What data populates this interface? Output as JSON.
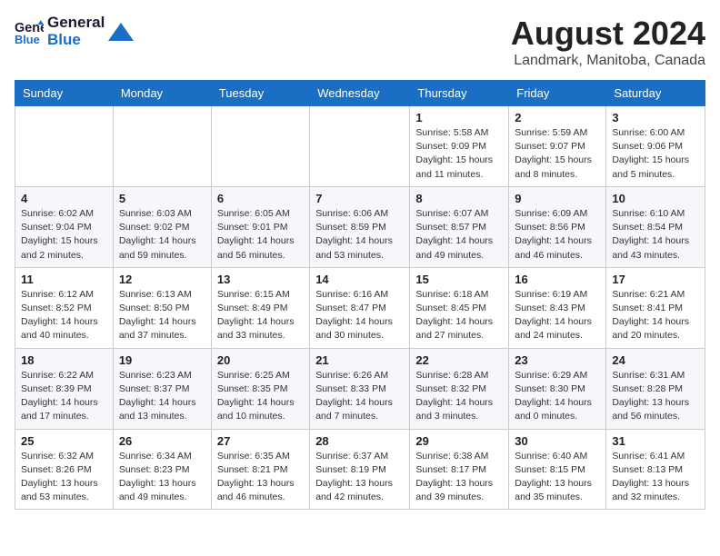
{
  "header": {
    "logo_line1": "General",
    "logo_line2": "Blue",
    "month_year": "August 2024",
    "location": "Landmark, Manitoba, Canada"
  },
  "days_of_week": [
    "Sunday",
    "Monday",
    "Tuesday",
    "Wednesday",
    "Thursday",
    "Friday",
    "Saturday"
  ],
  "weeks": [
    [
      {
        "day": "",
        "info": ""
      },
      {
        "day": "",
        "info": ""
      },
      {
        "day": "",
        "info": ""
      },
      {
        "day": "",
        "info": ""
      },
      {
        "day": "1",
        "info": "Sunrise: 5:58 AM\nSunset: 9:09 PM\nDaylight: 15 hours\nand 11 minutes."
      },
      {
        "day": "2",
        "info": "Sunrise: 5:59 AM\nSunset: 9:07 PM\nDaylight: 15 hours\nand 8 minutes."
      },
      {
        "day": "3",
        "info": "Sunrise: 6:00 AM\nSunset: 9:06 PM\nDaylight: 15 hours\nand 5 minutes."
      }
    ],
    [
      {
        "day": "4",
        "info": "Sunrise: 6:02 AM\nSunset: 9:04 PM\nDaylight: 15 hours\nand 2 minutes."
      },
      {
        "day": "5",
        "info": "Sunrise: 6:03 AM\nSunset: 9:02 PM\nDaylight: 14 hours\nand 59 minutes."
      },
      {
        "day": "6",
        "info": "Sunrise: 6:05 AM\nSunset: 9:01 PM\nDaylight: 14 hours\nand 56 minutes."
      },
      {
        "day": "7",
        "info": "Sunrise: 6:06 AM\nSunset: 8:59 PM\nDaylight: 14 hours\nand 53 minutes."
      },
      {
        "day": "8",
        "info": "Sunrise: 6:07 AM\nSunset: 8:57 PM\nDaylight: 14 hours\nand 49 minutes."
      },
      {
        "day": "9",
        "info": "Sunrise: 6:09 AM\nSunset: 8:56 PM\nDaylight: 14 hours\nand 46 minutes."
      },
      {
        "day": "10",
        "info": "Sunrise: 6:10 AM\nSunset: 8:54 PM\nDaylight: 14 hours\nand 43 minutes."
      }
    ],
    [
      {
        "day": "11",
        "info": "Sunrise: 6:12 AM\nSunset: 8:52 PM\nDaylight: 14 hours\nand 40 minutes."
      },
      {
        "day": "12",
        "info": "Sunrise: 6:13 AM\nSunset: 8:50 PM\nDaylight: 14 hours\nand 37 minutes."
      },
      {
        "day": "13",
        "info": "Sunrise: 6:15 AM\nSunset: 8:49 PM\nDaylight: 14 hours\nand 33 minutes."
      },
      {
        "day": "14",
        "info": "Sunrise: 6:16 AM\nSunset: 8:47 PM\nDaylight: 14 hours\nand 30 minutes."
      },
      {
        "day": "15",
        "info": "Sunrise: 6:18 AM\nSunset: 8:45 PM\nDaylight: 14 hours\nand 27 minutes."
      },
      {
        "day": "16",
        "info": "Sunrise: 6:19 AM\nSunset: 8:43 PM\nDaylight: 14 hours\nand 24 minutes."
      },
      {
        "day": "17",
        "info": "Sunrise: 6:21 AM\nSunset: 8:41 PM\nDaylight: 14 hours\nand 20 minutes."
      }
    ],
    [
      {
        "day": "18",
        "info": "Sunrise: 6:22 AM\nSunset: 8:39 PM\nDaylight: 14 hours\nand 17 minutes."
      },
      {
        "day": "19",
        "info": "Sunrise: 6:23 AM\nSunset: 8:37 PM\nDaylight: 14 hours\nand 13 minutes."
      },
      {
        "day": "20",
        "info": "Sunrise: 6:25 AM\nSunset: 8:35 PM\nDaylight: 14 hours\nand 10 minutes."
      },
      {
        "day": "21",
        "info": "Sunrise: 6:26 AM\nSunset: 8:33 PM\nDaylight: 14 hours\nand 7 minutes."
      },
      {
        "day": "22",
        "info": "Sunrise: 6:28 AM\nSunset: 8:32 PM\nDaylight: 14 hours\nand 3 minutes."
      },
      {
        "day": "23",
        "info": "Sunrise: 6:29 AM\nSunset: 8:30 PM\nDaylight: 14 hours\nand 0 minutes."
      },
      {
        "day": "24",
        "info": "Sunrise: 6:31 AM\nSunset: 8:28 PM\nDaylight: 13 hours\nand 56 minutes."
      }
    ],
    [
      {
        "day": "25",
        "info": "Sunrise: 6:32 AM\nSunset: 8:26 PM\nDaylight: 13 hours\nand 53 minutes."
      },
      {
        "day": "26",
        "info": "Sunrise: 6:34 AM\nSunset: 8:23 PM\nDaylight: 13 hours\nand 49 minutes."
      },
      {
        "day": "27",
        "info": "Sunrise: 6:35 AM\nSunset: 8:21 PM\nDaylight: 13 hours\nand 46 minutes."
      },
      {
        "day": "28",
        "info": "Sunrise: 6:37 AM\nSunset: 8:19 PM\nDaylight: 13 hours\nand 42 minutes."
      },
      {
        "day": "29",
        "info": "Sunrise: 6:38 AM\nSunset: 8:17 PM\nDaylight: 13 hours\nand 39 minutes."
      },
      {
        "day": "30",
        "info": "Sunrise: 6:40 AM\nSunset: 8:15 PM\nDaylight: 13 hours\nand 35 minutes."
      },
      {
        "day": "31",
        "info": "Sunrise: 6:41 AM\nSunset: 8:13 PM\nDaylight: 13 hours\nand 32 minutes."
      }
    ]
  ]
}
